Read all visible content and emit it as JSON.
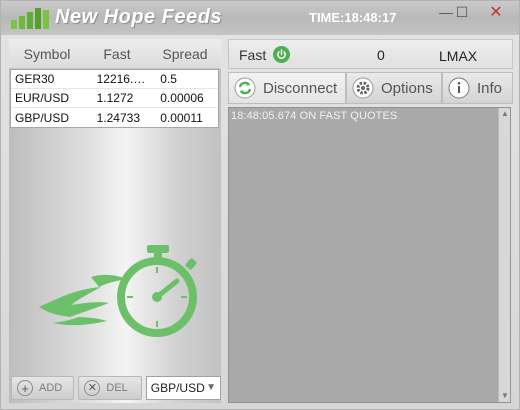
{
  "app": {
    "title": "New Hope Feeds",
    "time": "TIME:18:48:17",
    "logo_icon": "bar-chart-logo-icon"
  },
  "window_controls": {
    "minimize": "—",
    "maximize": "☐",
    "close": "✕"
  },
  "table": {
    "headers": [
      "Symbol",
      "Fast",
      "Spread"
    ],
    "rows": [
      {
        "symbol": "GER30",
        "fast": "12216.…",
        "spread": "0.5"
      },
      {
        "symbol": "EUR/USD",
        "fast": "1.1272",
        "spread": "0.00006"
      },
      {
        "symbol": "GBP/USD",
        "fast": "1.24733",
        "spread": "0.00011"
      }
    ]
  },
  "bottom": {
    "add_label": "ADD",
    "del_label": "DEL",
    "symbol_select": "GBP/USD"
  },
  "status": {
    "fast_label": "Fast",
    "count": "0",
    "feed_name": "LMAX"
  },
  "toolbar": {
    "disconnect_label": "Disconnect",
    "options_label": "Options",
    "info_label": "Info"
  },
  "log": {
    "lines": [
      "18:48:05.674 ON FAST QUOTES"
    ]
  },
  "colors": {
    "accent_green": "#4caf50",
    "log_background": "#a9a9a9"
  }
}
